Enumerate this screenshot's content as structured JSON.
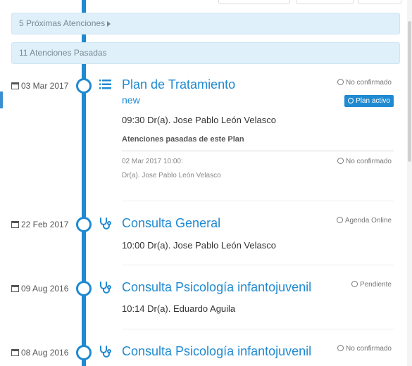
{
  "banners": {
    "upcoming": "5 Próximas Atenciones",
    "past": "11 Atenciones Pasadas"
  },
  "entries": [
    {
      "date": "03 Mar 2017",
      "icon": "list-icon",
      "title": "Plan de Tratamiento",
      "subtitle": "new",
      "line": "09:30 Dr(a). Jose Pablo León Velasco",
      "status": "No confirmado",
      "badge": "Plan activo",
      "section_label": "Atenciones pasadas de este Plan",
      "past": {
        "date": "02 Mar 2017 10:00:",
        "doctor": "Dr(a). Jose Pablo León Velasco",
        "status": "No confirmado"
      }
    },
    {
      "date": "22 Feb 2017",
      "icon": "stethoscope-icon",
      "title": "Consulta General",
      "line": "10:00 Dr(a). Jose Pablo León Velasco",
      "status": "Agenda Online"
    },
    {
      "date": "09 Aug 2016",
      "icon": "stethoscope-icon",
      "title": "Consulta Psicología infantojuvenil",
      "line": "10:14 Dr(a). Eduardo Aguila",
      "status": "Pendiente"
    },
    {
      "date": "08 Aug 2016",
      "icon": "stethoscope-icon",
      "title": "Consulta Psicología infantojuvenil",
      "status": "No confirmado"
    }
  ],
  "colors": {
    "accent": "#1f8ad1",
    "banner_bg": "#dff0fa"
  }
}
